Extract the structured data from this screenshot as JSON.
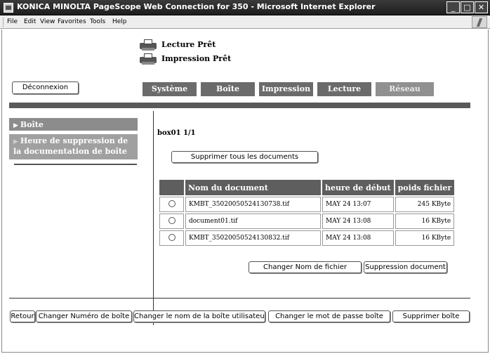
{
  "window": {
    "title": "KONICA MINOLTA PageScope Web Connection for 350 - Microsoft Internet Explorer",
    "minimize_glyph": "_",
    "maximize_glyph": "□",
    "close_glyph": "✕"
  },
  "menu": [
    "File",
    "Edit",
    "View",
    "Favorites",
    "Tools",
    "Help"
  ],
  "status": {
    "scan": "Lecture Prêt",
    "print": "Impression Prêt"
  },
  "logout_label": "Déconnexion",
  "tabs": [
    "Système",
    "Boîte",
    "Impression",
    "Lecture",
    "Réseau"
  ],
  "sidebar": {
    "item1": "Boîte",
    "item2": "Heure de suppression de la documentation de boîte",
    "arrow": "▶"
  },
  "box": {
    "label": "box01  1/1",
    "delete_all_label": "Supprimer tous les documents"
  },
  "table": {
    "headers": [
      "",
      "Nom du document",
      "heure de début",
      "poids fichier"
    ],
    "rows": [
      {
        "name": "KMBT_35020050524130738.tif",
        "time": "MAY 24 13:07",
        "size": "245 KByte"
      },
      {
        "name": "document01.tif",
        "time": "MAY 24 13:08",
        "size": "16 KByte"
      },
      {
        "name": "KMBT_35020050524130832.tif",
        "time": "MAY 24 13:08",
        "size": "16 KByte"
      }
    ]
  },
  "actions": {
    "rename_file": "Changer Nom de fichier",
    "delete_document": "Suppression document"
  },
  "bottom_buttons": {
    "back": "Retour",
    "change_box_number": "Changer Numéro de boîte",
    "change_user_box_name": "Changer le nom de la boîte utilisateur",
    "change_box_password": "Changer le mot de passe boîte",
    "delete_box": "Supprimer boîte"
  }
}
